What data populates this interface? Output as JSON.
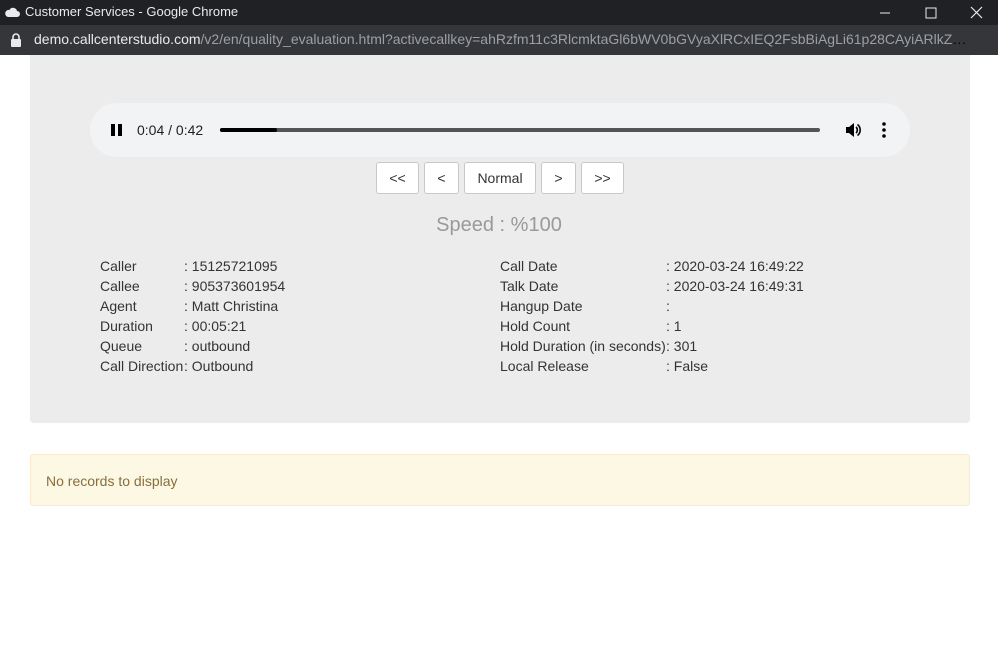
{
  "window": {
    "title": "Customer Services - Google Chrome",
    "url_host": "demo.callcenterstudio.com",
    "url_path": "/v2/en/quality_evaluation.html?activecallkey=ahRzfm11c3RlcmktaGl6bWV0bGVyaXlRCxIEQ2FsbBiAgLi61p28CAyiARlkZW1vLWNhbGxjZW50ZXJzdHVkaW8..."
  },
  "player": {
    "time": "0:04 / 0:42",
    "progress": 0.095,
    "pause_icon": "pause-icon",
    "volume_icon": "volume-icon",
    "menu_icon": "more-vert-icon"
  },
  "controls": {
    "first": "<<",
    "prev": "<",
    "normal": "Normal",
    "next": ">",
    "last": ">>"
  },
  "speed": "Speed : %100",
  "details_left": [
    {
      "label": "Caller",
      "value": ": 15125721095"
    },
    {
      "label": "Callee",
      "value": ": 905373601954"
    },
    {
      "label": "Agent",
      "value": ": Matt Christina"
    },
    {
      "label": "Duration",
      "value": ": 00:05:21"
    },
    {
      "label": "Queue",
      "value": ": outbound"
    },
    {
      "label": "Call Direction",
      "value": ": Outbound"
    }
  ],
  "details_right": [
    {
      "label": "Call Date",
      "value": ": 2020-03-24 16:49:22"
    },
    {
      "label": "Talk Date",
      "value": ": 2020-03-24 16:49:31"
    },
    {
      "label": "Hangup Date",
      "value": ":"
    },
    {
      "label": "Hold Count",
      "value": ": 1"
    },
    {
      "label": "Hold Duration (in seconds)",
      "value": ": 301"
    },
    {
      "label": "Local Release",
      "value": ": False"
    }
  ],
  "notice": "No records to display",
  "colors": {
    "panel": "#ececec",
    "notice_bg": "#fcf8e3",
    "notice_text": "#8a6d3b"
  }
}
